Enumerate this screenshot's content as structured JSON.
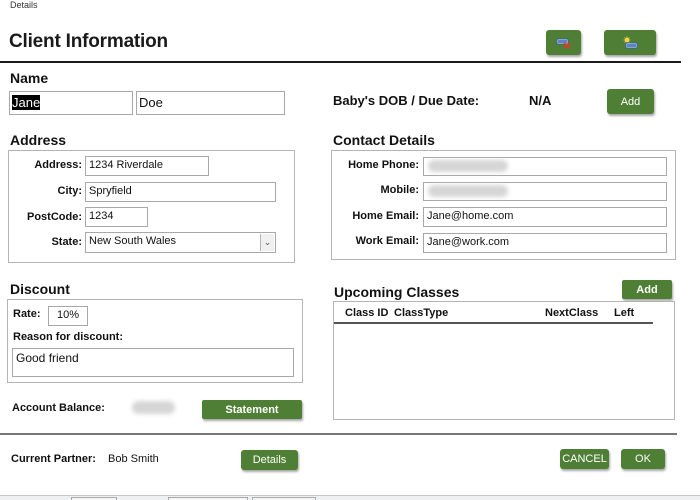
{
  "window": {
    "title": "Details"
  },
  "header": {
    "title": "Client Information",
    "icon_buttons": [
      {
        "icon": "delete-record-icon",
        "tooltip": ""
      },
      {
        "icon": "new-record-icon",
        "tooltip": ""
      }
    ]
  },
  "name": {
    "section_label": "Name",
    "first_name": "Jane",
    "last_name": "Doe"
  },
  "baby": {
    "label": "Baby's DOB / Due Date:",
    "value": "N/A",
    "add_label": "Add"
  },
  "address": {
    "section_label": "Address",
    "address_label": "Address:",
    "address_value": "1234 Riverdale",
    "city_label": "City:",
    "city_value": "Spryfield",
    "postcode_label": "PostCode:",
    "postcode_value": "1234",
    "state_label": "State:",
    "state_value": "New South Wales"
  },
  "contact": {
    "section_label": "Contact Details",
    "home_phone_label": "Home Phone:",
    "home_phone_value": "",
    "mobile_label": "Mobile:",
    "mobile_value": "",
    "home_email_label": "Home Email:",
    "home_email_value": "Jane@home.com",
    "work_email_label": "Work Email:",
    "work_email_value": "Jane@work.com"
  },
  "discount": {
    "section_label": "Discount",
    "rate_label": "Rate:",
    "rate_value": "10%",
    "reason_label": "Reason for discount:",
    "reason_value": "Good friend"
  },
  "account": {
    "balance_label": "Account Balance:",
    "balance_value": "",
    "statement_label": "Statement"
  },
  "classes": {
    "section_label": "Upcoming Classes",
    "add_label": "Add",
    "columns": [
      "Class ID",
      "ClassType",
      "NextClass",
      "Left"
    ],
    "rows": []
  },
  "partner": {
    "label": "Current Partner:",
    "value": "Bob Smith",
    "details_label": "Details"
  },
  "footer": {
    "cancel_label": "CANCEL",
    "ok_label": "OK"
  },
  "colors": {
    "button_green": "#4f7f35"
  }
}
